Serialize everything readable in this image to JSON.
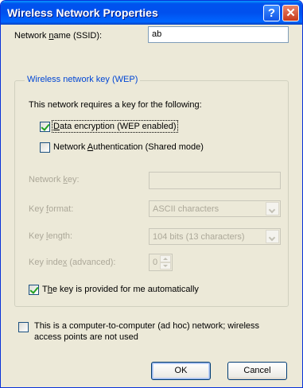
{
  "window": {
    "title": "Wireless Network Properties"
  },
  "titlebar_buttons": {
    "help": "?",
    "close": "✕"
  },
  "ssid": {
    "label_pre": "Network ",
    "label_accel": "n",
    "label_post": "ame (SSID):",
    "value": "ab"
  },
  "wep_group": {
    "title": "Wireless network key (WEP)",
    "requires_text": "This network requires a key for the following:",
    "data_encryption": {
      "label_pre": "",
      "label_accel": "D",
      "label_post": "ata encryption (WEP enabled)",
      "checked": true
    },
    "network_auth": {
      "label_pre": "Network ",
      "label_accel": "A",
      "label_post": "uthentication (Shared mode)",
      "checked": false
    },
    "network_key": {
      "label_pre": "Network ",
      "label_accel": "k",
      "label_post": "ey:",
      "value": ""
    },
    "key_format": {
      "label_pre": "Key ",
      "label_accel": "f",
      "label_post": "ormat:",
      "value": "ASCII characters"
    },
    "key_length": {
      "label_pre": "Key ",
      "label_accel": "l",
      "label_post": "ength:",
      "value": "104 bits (13 characters)"
    },
    "key_index": {
      "label_pre": "Key inde",
      "label_accel": "x",
      "label_post": " (advanced):",
      "value": "0"
    },
    "auto_key": {
      "label_pre": "T",
      "label_accel": "h",
      "label_post": "e key is provided for me automatically",
      "checked": true
    }
  },
  "adhoc": {
    "label_line1": "This is a computer-to-computer (ad hoc) network; wireless",
    "label_line2": "access points are not used",
    "checked": false
  },
  "buttons": {
    "ok": "OK",
    "cancel": "Cancel"
  }
}
